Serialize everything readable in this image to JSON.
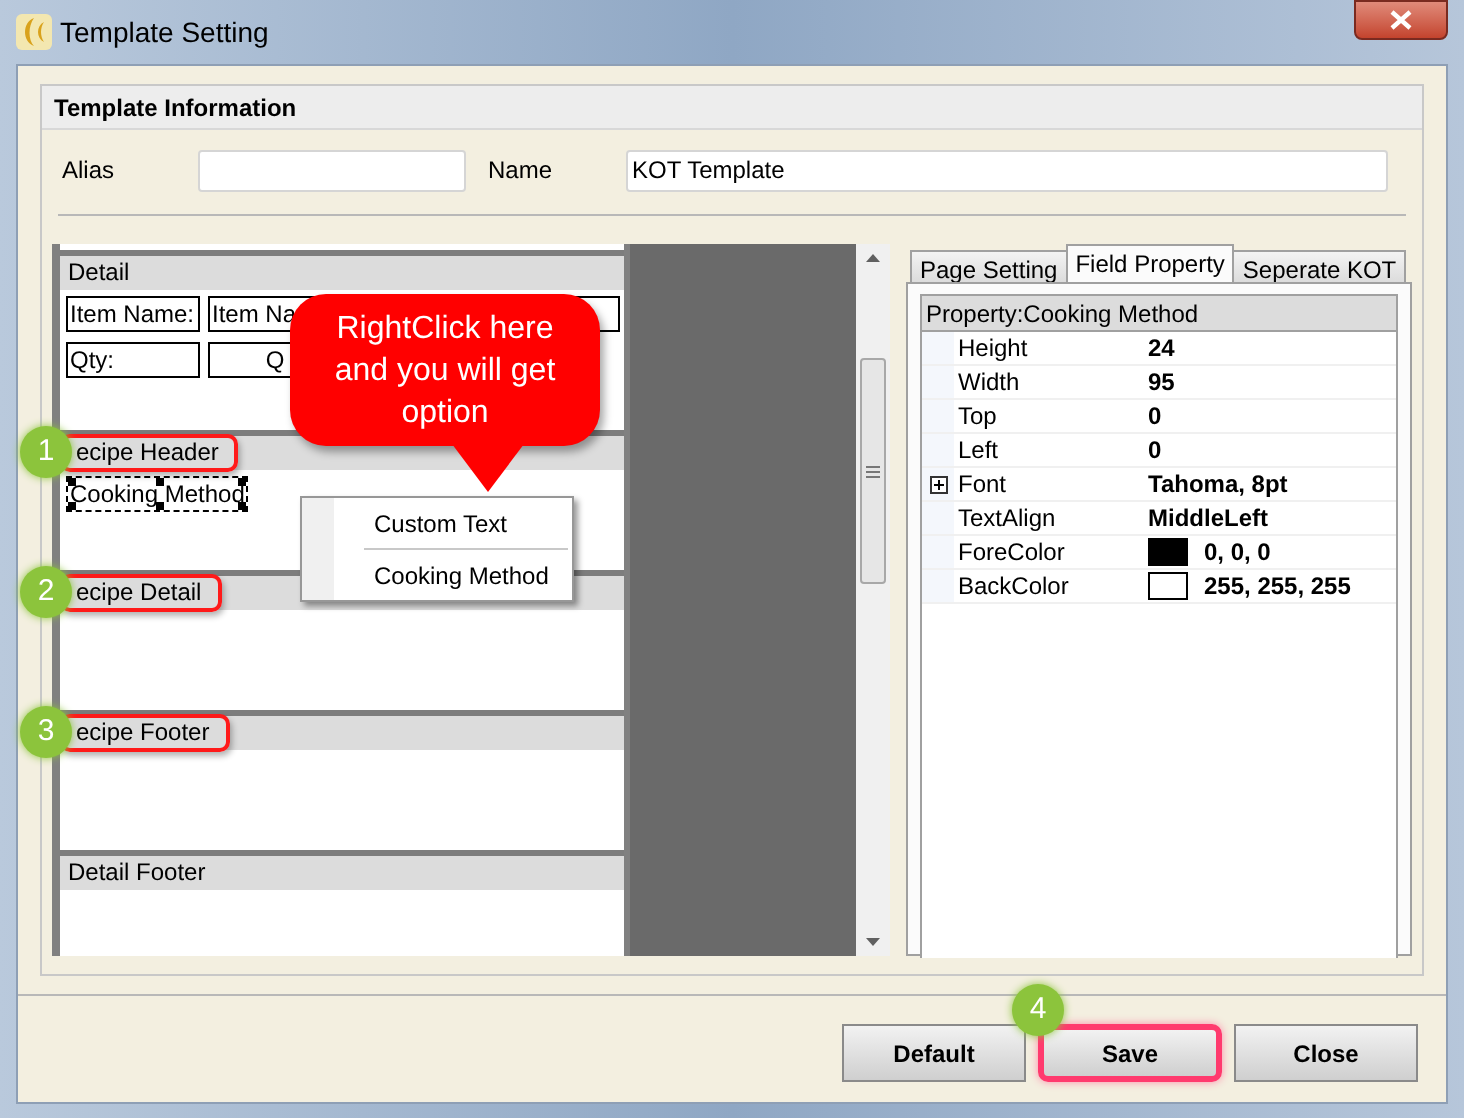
{
  "window": {
    "title": "Template Setting"
  },
  "template_information": {
    "title": "Template Information",
    "alias": {
      "label": "Alias"
    },
    "name": {
      "label": "Name",
      "value": "KOT Template"
    }
  },
  "sections": [
    {
      "title": "Detail",
      "highlighted": false,
      "rows": [
        [
          {
            "text": "Item Name:",
            "selected": false
          },
          {
            "text": "Item Na",
            "selected": false
          }
        ],
        [
          {
            "text": "Qty:",
            "selected": false
          },
          {
            "text": "Q",
            "selected": false
          }
        ]
      ]
    },
    {
      "title": "ecipe Header",
      "highlighted": true,
      "step": "1",
      "rows": [
        [
          {
            "text": "Cooking Method",
            "selected": true
          }
        ]
      ]
    },
    {
      "title": "ecipe Detail",
      "highlighted": true,
      "step": "2"
    },
    {
      "title": "ecipe Footer",
      "highlighted": true,
      "step": "3"
    },
    {
      "title": "Detail Footer",
      "highlighted": false
    }
  ],
  "callout": {
    "text": "RightClick here and you will get option"
  },
  "context_menu": {
    "items": [
      "Custom Text",
      "Cooking Method"
    ]
  },
  "tabs": [
    {
      "label": "Page Setting",
      "selected": false
    },
    {
      "label": "Field Property",
      "selected": true
    },
    {
      "label": "Seperate KOT",
      "selected": false
    }
  ],
  "property_grid": {
    "title": "Property:Cooking Method",
    "rows": [
      {
        "name": "Height",
        "value": "24",
        "kind": "text"
      },
      {
        "name": "Width",
        "value": "95",
        "kind": "text"
      },
      {
        "name": "Top",
        "value": "0",
        "kind": "text"
      },
      {
        "name": "Left",
        "value": "0",
        "kind": "text"
      },
      {
        "name": "Font",
        "value": "Tahoma, 8pt",
        "kind": "text",
        "expanded": false
      },
      {
        "name": "TextAlign",
        "value": "MiddleLeft",
        "kind": "text"
      },
      {
        "name": "ForeColor",
        "value": "0, 0, 0",
        "kind": "color",
        "color": "#000000"
      },
      {
        "name": "BackColor",
        "value": "255, 255, 255",
        "kind": "color",
        "color": "#ffffff"
      }
    ]
  },
  "buttons": [
    {
      "label": "Default",
      "highlighted": false
    },
    {
      "label": "Save",
      "highlighted": true,
      "step": "4"
    },
    {
      "label": "Close",
      "highlighted": false
    }
  ]
}
